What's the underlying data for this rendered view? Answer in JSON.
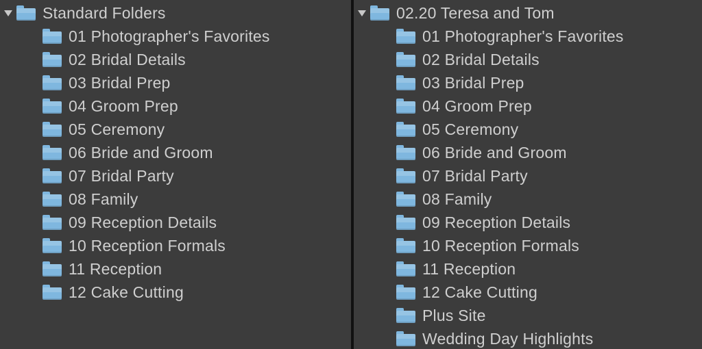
{
  "left": {
    "header": "Standard Folders",
    "items": [
      "01 Photographer's Favorites",
      "02 Bridal Details",
      "03 Bridal Prep",
      "04 Groom Prep",
      "05 Ceremony",
      "06 Bride and Groom",
      "07 Bridal Party",
      "08 Family",
      "09 Reception Details",
      "10 Reception Formals",
      "11 Reception",
      "12 Cake Cutting"
    ]
  },
  "right": {
    "header": "02.20 Teresa and Tom",
    "items": [
      "01 Photographer's Favorites",
      "02 Bridal Details",
      "03 Bridal Prep",
      "04 Groom Prep",
      "05 Ceremony",
      "06 Bride and Groom",
      "07 Bridal Party",
      "08 Family",
      "09 Reception Details",
      "10 Reception Formals",
      "11 Reception",
      "12 Cake Cutting",
      "Plus Site",
      "Wedding Day Highlights"
    ]
  }
}
